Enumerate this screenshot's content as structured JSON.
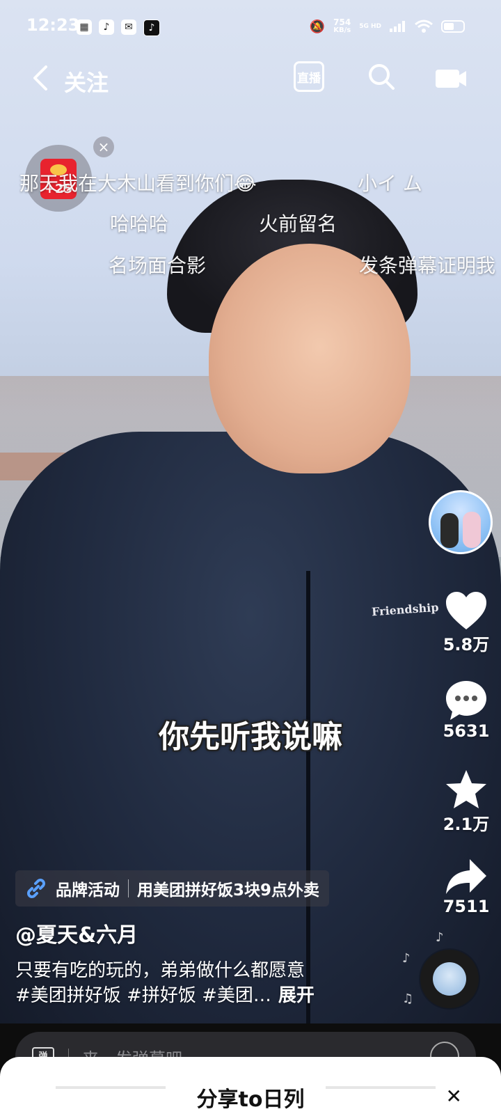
{
  "status_bar": {
    "time": "12:23",
    "net_speed_value": "754",
    "net_speed_unit": "KB/s",
    "network": "5G HD"
  },
  "top_nav": {
    "follow_label": "关注",
    "live_label": "直播"
  },
  "red_packet": {
    "bonus": "+25"
  },
  "danmu": [
    "那天我在大木山看到你们😂",
    "小イ ム",
    "哈哈哈",
    "火前留名",
    "名场面合影",
    "发条弹幕证明我"
  ],
  "subtitle": "你先听我说嘛",
  "actions": {
    "likes": "5.8万",
    "comments": "5631",
    "favorites": "2.1万",
    "shares": "7511"
  },
  "brand": {
    "tag": "品牌活动",
    "text": "用美团拼好饭3块9点外卖"
  },
  "author": "@夏天&六月",
  "description": {
    "line1": "只要有吃的玩的，弟弟做什么都愿意",
    "line2": "#美团拼好饭 #拼好饭 #美团…",
    "expand": "展开"
  },
  "jacket_text": "Friendship",
  "comment_bar": {
    "danmu_toggle": "弹",
    "placeholder": "来一发弹幕吧"
  },
  "sheet": {
    "title": "分享to日列"
  },
  "colors": {
    "red_packet": "#e8232e",
    "bottom_bar": "#0d0d0d"
  }
}
